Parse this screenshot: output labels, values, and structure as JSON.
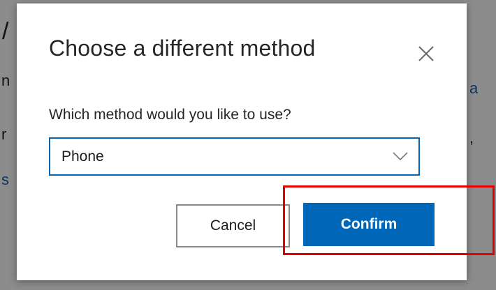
{
  "dialog": {
    "title": "Choose a different method",
    "close_icon": "close-icon",
    "field_label": "Which method would you like to use?",
    "method_select": {
      "selected": "Phone",
      "icon": "chevron-down-icon"
    },
    "cancel_label": "Cancel",
    "confirm_label": "Confirm"
  },
  "colors": {
    "accent": "#0067b8",
    "highlight": "#e00000"
  }
}
